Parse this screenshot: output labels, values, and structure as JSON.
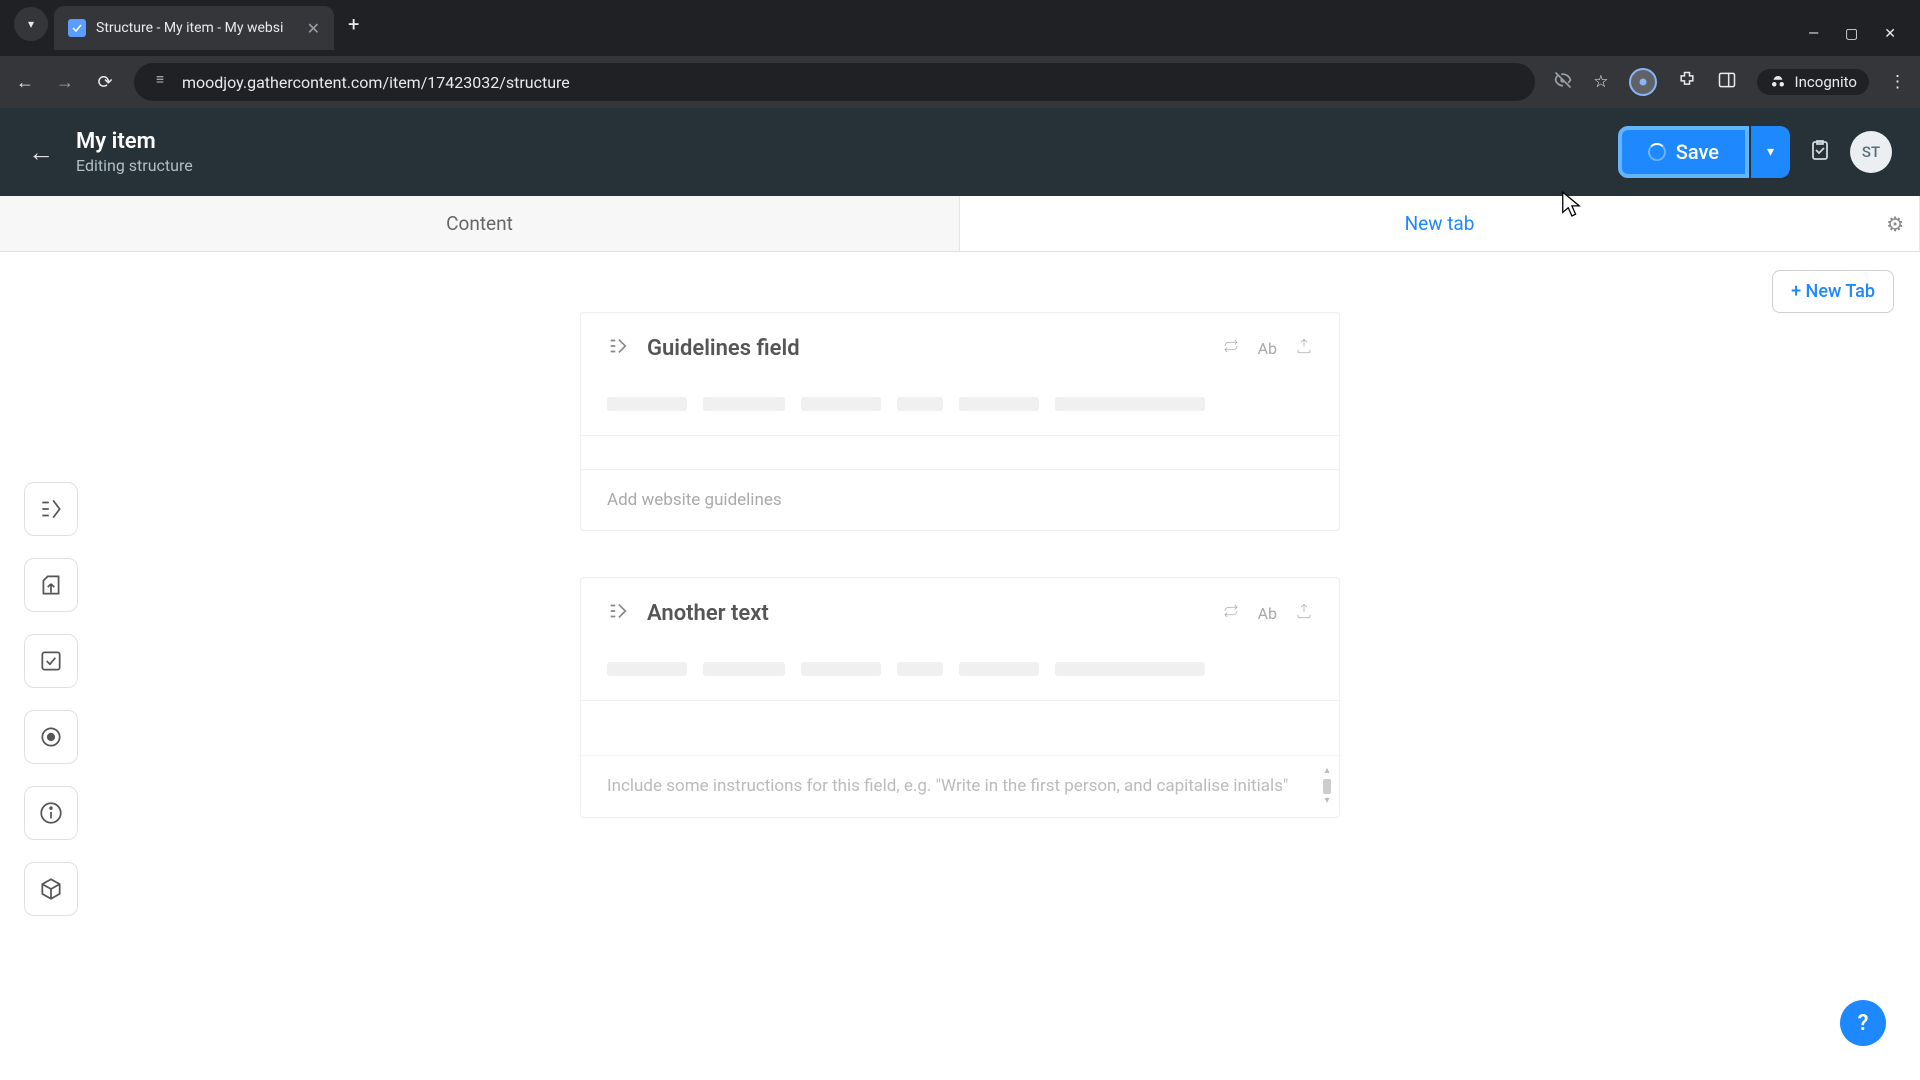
{
  "browser": {
    "tab_title": "Structure - My item - My websi",
    "url": "moodjoy.gathercontent.com/item/17423032/structure",
    "incognito_label": "Incognito"
  },
  "header": {
    "title": "My item",
    "subtitle": "Editing structure",
    "save_label": "Save",
    "avatar_initials": "ST"
  },
  "tabs": {
    "content_label": "Content",
    "newtab_label": "New tab",
    "add_tab_label": "+ New Tab"
  },
  "fields": [
    {
      "label": "Guidelines field",
      "ab": "Ab",
      "placeholder": "Add website guidelines"
    },
    {
      "label": "Another text",
      "ab": "Ab",
      "instructions": "Include some instructions for this field, e.g. \"Write in the first person, and capitalise initials\""
    }
  ],
  "help": {
    "label": "?"
  }
}
